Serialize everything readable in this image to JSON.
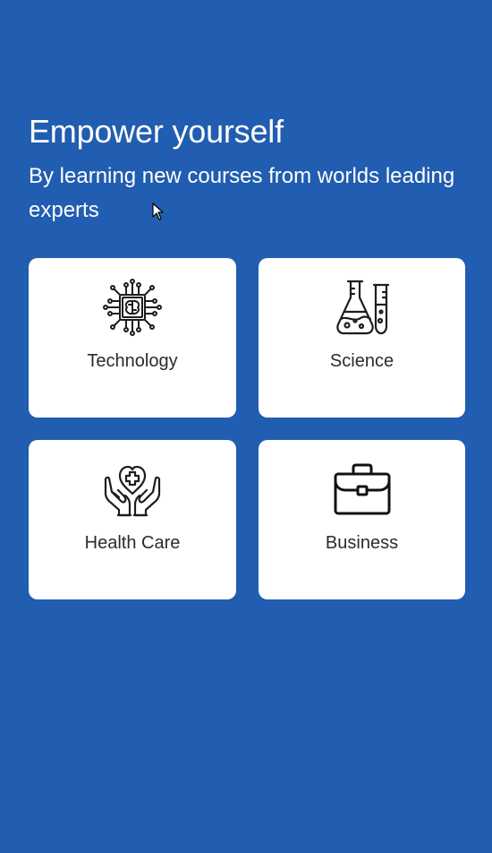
{
  "hero": {
    "title": "Empower yourself",
    "subtitle": "By learning new courses from worlds leading experts"
  },
  "categories": [
    {
      "label": "Technology",
      "icon": "brain-chip-icon"
    },
    {
      "label": "Science",
      "icon": "lab-flasks-icon"
    },
    {
      "label": "Health Care",
      "icon": "heart-hands-icon"
    },
    {
      "label": "Business",
      "icon": "briefcase-icon"
    }
  ],
  "colors": {
    "background": "#215db0",
    "card": "#ffffff",
    "text": "#2b2b2b"
  }
}
